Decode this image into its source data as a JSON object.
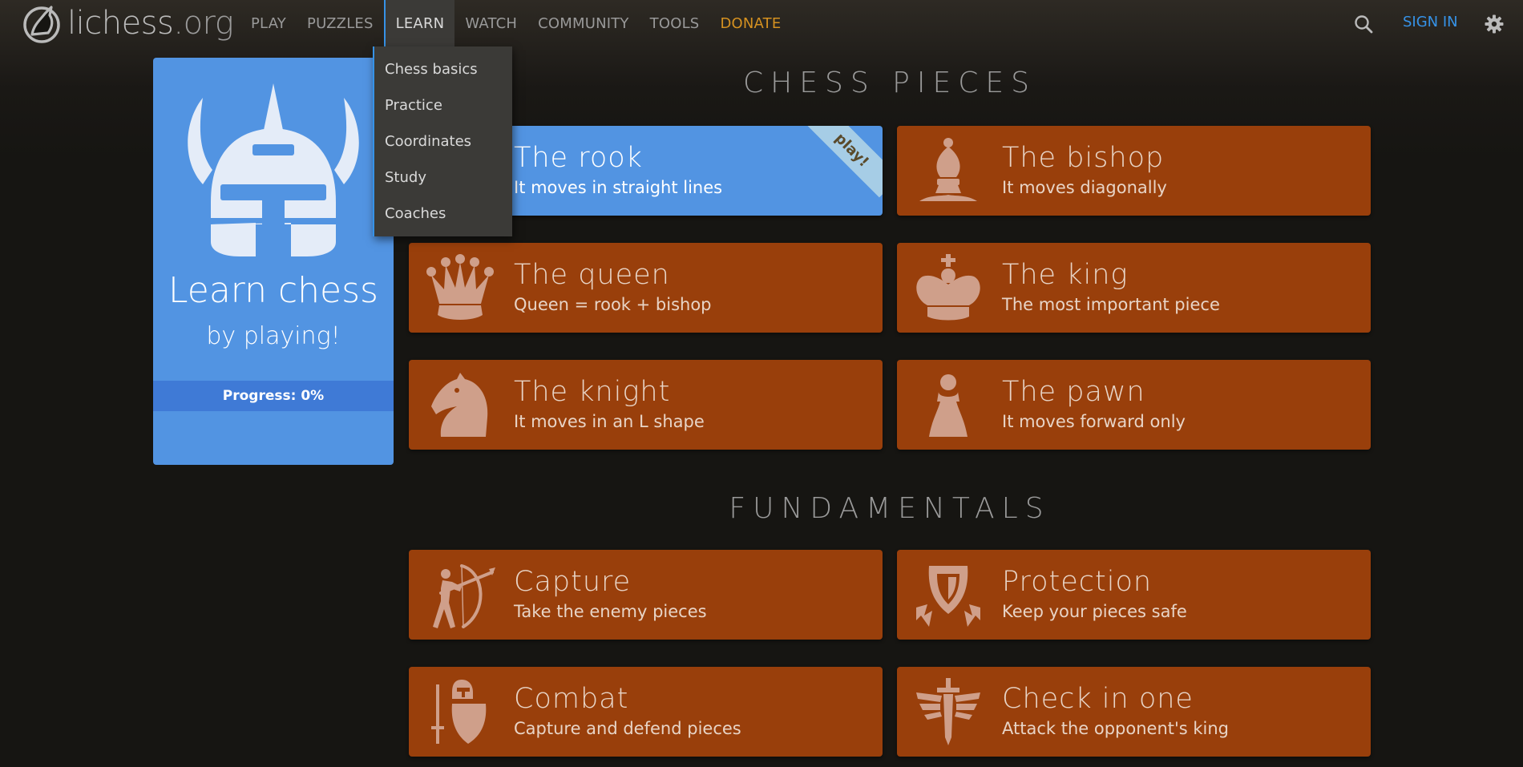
{
  "header": {
    "logo_text": "lichess",
    "logo_tld": ".org",
    "nav": [
      {
        "label": "PLAY"
      },
      {
        "label": "PUZZLES"
      },
      {
        "label": "LEARN",
        "active": true
      },
      {
        "label": "WATCH"
      },
      {
        "label": "COMMUNITY"
      },
      {
        "label": "TOOLS"
      },
      {
        "label": "DONATE"
      }
    ],
    "sign_in": "SIGN IN",
    "search_icon": "search-icon",
    "settings_icon": "gear-icon"
  },
  "learn_menu": {
    "items": [
      "Chess basics",
      "Practice",
      "Coordinates",
      "Study",
      "Coaches"
    ]
  },
  "side": {
    "title": "Learn chess",
    "subtitle": "by playing!",
    "progress": "Progress: 0%",
    "icon": "helmet-icon"
  },
  "sections": [
    {
      "title": "CHESS PIECES",
      "cards": [
        {
          "title": "The rook",
          "desc": "It moves in straight lines",
          "icon": "rook-icon",
          "current": true,
          "ribbon": "play!"
        },
        {
          "title": "The bishop",
          "desc": "It moves diagonally",
          "icon": "bishop-icon"
        },
        {
          "title": "The queen",
          "desc": "Queen = rook + bishop",
          "icon": "queen-icon"
        },
        {
          "title": "The king",
          "desc": "The most important piece",
          "icon": "king-icon"
        },
        {
          "title": "The knight",
          "desc": "It moves in an L shape",
          "icon": "knight-icon"
        },
        {
          "title": "The pawn",
          "desc": "It moves forward only",
          "icon": "pawn-icon"
        }
      ]
    },
    {
      "title": "FUNDAMENTALS",
      "cards": [
        {
          "title": "Capture",
          "desc": "Take the enemy pieces",
          "icon": "archer-icon"
        },
        {
          "title": "Protection",
          "desc": "Keep your pieces safe",
          "icon": "shield-icon"
        },
        {
          "title": "Combat",
          "desc": "Capture and defend pieces",
          "icon": "knight-shield-icon"
        },
        {
          "title": "Check in one",
          "desc": "Attack the opponent's king",
          "icon": "winged-sword-icon"
        }
      ]
    }
  ],
  "colors": {
    "background": "#161512",
    "accent_blue": "#5294e2",
    "card_orange": "#993f0b",
    "donate": "#d59120",
    "link_blue": "#3692e7"
  }
}
